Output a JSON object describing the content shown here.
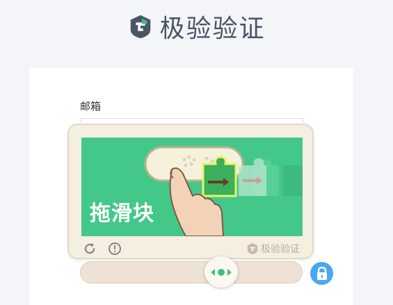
{
  "header": {
    "brand_name": "极验验证",
    "logo_icon": "geetest-logo-icon"
  },
  "form": {
    "email_label": "邮箱"
  },
  "captcha": {
    "instruction_text": "拖滑块",
    "brand_name": "极验验证",
    "refresh_icon": "refresh-icon",
    "feedback_icon": "exclamation-circle-icon",
    "slider_progress": 0.6
  },
  "colors": {
    "page_bg": "#f3f5f8",
    "puzzle_green": "#43c88a",
    "lock_blue": "#4aa7ef",
    "widget_beige": "#f5efe2"
  }
}
